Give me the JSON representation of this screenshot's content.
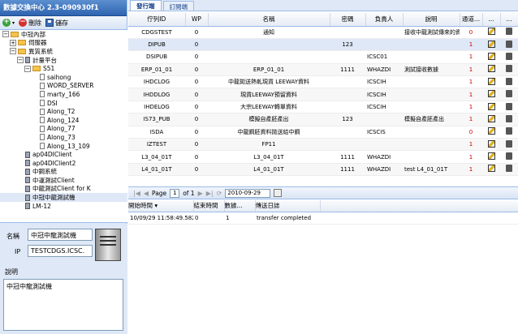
{
  "app": {
    "title": "數據交換中心 2.3-090930f1"
  },
  "toolbar": {
    "add": "",
    "delete": "刪除",
    "save": "儲存"
  },
  "tree": [
    {
      "label": "中冠內部",
      "depth": 0,
      "toggle": "−",
      "icon": "folder"
    },
    {
      "label": "伺服器",
      "depth": 1,
      "toggle": "+",
      "icon": "folder"
    },
    {
      "label": "異質系統",
      "depth": 1,
      "toggle": "−",
      "icon": "folder"
    },
    {
      "label": "計量平台",
      "depth": 2,
      "toggle": "−",
      "icon": "comp"
    },
    {
      "label": "S51",
      "depth": 3,
      "toggle": "−",
      "icon": "folder"
    },
    {
      "label": "saihong",
      "depth": 4,
      "toggle": "",
      "icon": "doc"
    },
    {
      "label": "WORD_SERVER",
      "depth": 4,
      "toggle": "",
      "icon": "doc"
    },
    {
      "label": "marty_166",
      "depth": 4,
      "toggle": "",
      "icon": "doc"
    },
    {
      "label": "DSI",
      "depth": 4,
      "toggle": "",
      "icon": "doc"
    },
    {
      "label": "Along_T2",
      "depth": 4,
      "toggle": "",
      "icon": "doc"
    },
    {
      "label": "Along_124",
      "depth": 4,
      "toggle": "",
      "icon": "doc"
    },
    {
      "label": "Along_77",
      "depth": 4,
      "toggle": "",
      "icon": "doc"
    },
    {
      "label": "Along_73",
      "depth": 4,
      "toggle": "",
      "icon": "doc"
    },
    {
      "label": "Along_13_109",
      "depth": 4,
      "toggle": "",
      "icon": "doc"
    },
    {
      "label": "ap04DIClient",
      "depth": 2,
      "toggle": "",
      "icon": "comp"
    },
    {
      "label": "ap04DIClient2",
      "depth": 2,
      "toggle": "",
      "icon": "comp"
    },
    {
      "label": "中鋼系統",
      "depth": 2,
      "toggle": "",
      "icon": "comp"
    },
    {
      "label": "中運測試Client",
      "depth": 2,
      "toggle": "",
      "icon": "comp"
    },
    {
      "label": "中龍測試Client for K",
      "depth": 2,
      "toggle": "",
      "icon": "comp"
    },
    {
      "label": "中冠中龍測試機",
      "depth": 2,
      "toggle": "",
      "icon": "comp"
    },
    {
      "label": "LM-12",
      "depth": 2,
      "toggle": "",
      "icon": "comp"
    }
  ],
  "detail": {
    "name_label": "名稱",
    "name_value": "中冠中龍測試機",
    "ip_label": "IP",
    "ip_value": "TESTCDGS.ICSC.",
    "desc_label": "說明",
    "desc_value": "中冠中龍測試機"
  },
  "tabs": [
    "發行端",
    "訂閱端"
  ],
  "grid": {
    "columns": [
      "佇列ID",
      "WP",
      "名稱",
      "密碼",
      "負責人",
      "說明",
      "通道...",
      "...",
      "..."
    ],
    "rows": [
      [
        "CDGSTEST",
        "0",
        "通知",
        "",
        "",
        "接收中龍測試傳來的資",
        "0"
      ],
      [
        "DIPUB",
        "0",
        "",
        "123",
        "",
        "",
        "1"
      ],
      [
        "DSIPUB",
        "0",
        "",
        "",
        "ICSC01",
        "",
        "1"
      ],
      [
        "ERP_01_01",
        "0",
        "ERP_01_01",
        "1111",
        "WHAZDI",
        "測試接收數據",
        "1"
      ],
      [
        "IHDCLOG",
        "0",
        "中龍拋送熱軋現貨 LEEWAY資料",
        "",
        "ICSCIH",
        "",
        "1"
      ],
      [
        "IHDDLOG",
        "0",
        "現貨LEEWAY預留資料",
        "",
        "ICSCIH",
        "",
        "1"
      ],
      [
        "IHDELOG",
        "0",
        "大宗LEEWAY轉單資料",
        "",
        "ICSCIH",
        "",
        "1"
      ],
      [
        "IS73_PUB",
        "0",
        "模擬自產胚產出",
        "123",
        "",
        "模擬自產胚產出",
        "1"
      ],
      [
        "ISDA",
        "0",
        "中龍鋼胚資料拋送給中鋼",
        "",
        "ICSCIS",
        "",
        "0"
      ],
      [
        "IZTEST",
        "0",
        "FP11",
        "",
        "",
        "",
        "1"
      ],
      [
        "L3_04_01T",
        "0",
        "L3_04_01T",
        "1111",
        "WHAZDI",
        "",
        "1"
      ],
      [
        "L4_01_01T",
        "0",
        "L4_01_01T",
        "1111",
        "WHAZDI",
        "test L4_01_01T",
        "1"
      ]
    ]
  },
  "pager": {
    "page_label": "Page",
    "page_value": "1",
    "of_label": "of 1",
    "date": "2010-09-29"
  },
  "log": {
    "columns": [
      "開始時間 ▾",
      "結束時間",
      "數據...",
      "傳送日誌"
    ],
    "rows": [
      [
        "10/09/29 11:58:49.582",
        "0",
        "1",
        "transfer completed"
      ]
    ]
  }
}
